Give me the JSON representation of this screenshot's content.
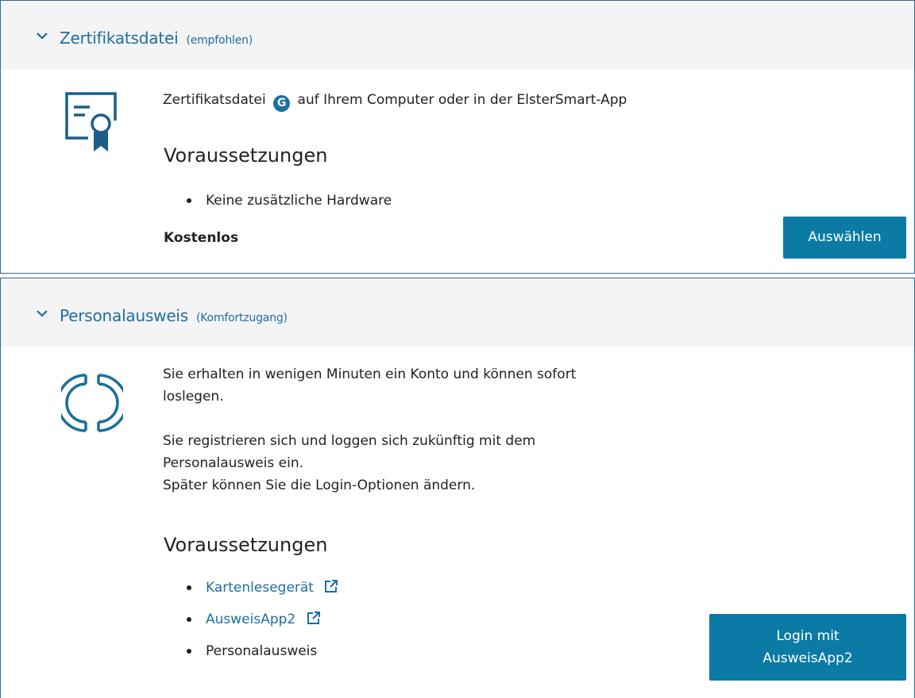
{
  "cert": {
    "title": "Zertifikatsdatei",
    "subtitle": "(empfohlen)",
    "description_before": "Zertifikatsdatei",
    "badge_letter": "G",
    "description_after": "auf Ihrem Computer oder in der ElsterSmart-App",
    "requirements_heading": "Voraussetzungen",
    "requirements": [
      "Keine zusätzliche Hardware"
    ],
    "price": "Kostenlos",
    "select_button": "Auswählen"
  },
  "ausweis": {
    "title": "Personalausweis",
    "subtitle": "(Komfortzugang)",
    "para1_line1": "Sie erhalten in wenigen Minuten ein Konto und können sofort",
    "para1_line2": "loslegen.",
    "para2_line1": "Sie registrieren sich und loggen sich zukünftig mit dem",
    "para2_line2": "Personalausweis ein.",
    "para2_line3": "Später können Sie die Login-Optionen ändern.",
    "requirements_heading": "Voraussetzungen",
    "requirements": [
      "Kartenlesegerät",
      "AusweisApp2",
      "Personalausweis"
    ],
    "login_button_line1": "Login mit",
    "login_button_line2": "AusweisApp2"
  },
  "icons": {
    "chevron": "chevron-down-icon",
    "certificate": "certificate-icon",
    "id_card": "eid-logo-icon",
    "external": "external-link-icon"
  },
  "colors": {
    "accent": "#1c6ea4",
    "button": "#0b7ba6",
    "border": "#2b6b9a",
    "header_bg": "#f4f4f4"
  }
}
